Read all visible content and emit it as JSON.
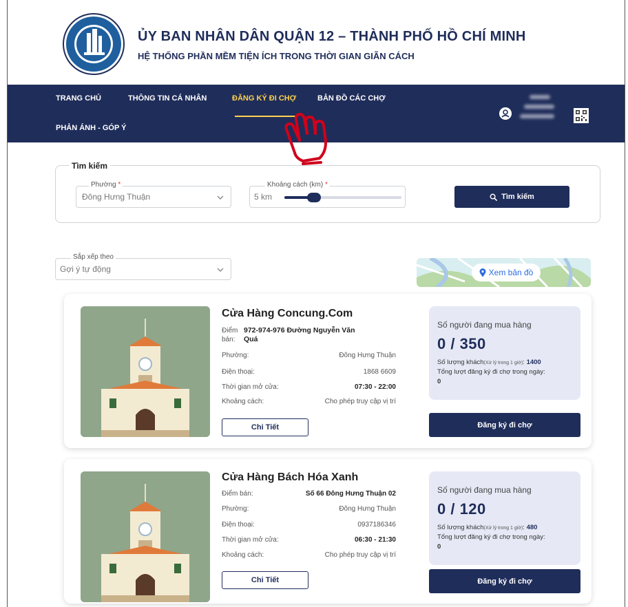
{
  "header": {
    "title": "ỦY BAN NHÂN DÂN QUẬN 12 – THÀNH PHỐ HỒ CHÍ MINH",
    "subtitle": "HỆ THỐNG PHẦN MỀM TIỆN ÍCH TRONG THỜI GIAN GIÃN CÁCH",
    "logo_text": "QUẬN 12 – THÀNH PHỐ HỒ CHÍ MINH"
  },
  "nav": {
    "items": [
      {
        "label": "TRANG CHỦ"
      },
      {
        "label": "THÔNG TIN CÁ NHÂN"
      },
      {
        "label": "ĐĂNG KÝ ĐI CHỢ"
      },
      {
        "label": "BẢN ĐỒ CÁC CHỢ"
      },
      {
        "label": "PHẢN ÁNH - GÓP Ý"
      }
    ],
    "active_index": 2
  },
  "search": {
    "legend": "Tìm kiếm",
    "ward_label": "Phường",
    "ward_value": "Đông Hưng Thuận",
    "distance_label": "Khoảng cách (km)",
    "distance_value": "5 km",
    "distance_slider_fraction": 0.25,
    "required_mark": "*",
    "button_label": "Tìm kiếm"
  },
  "sort": {
    "label": "Sắp xếp theo",
    "value": "Gợi ý tự động"
  },
  "map": {
    "button_label": "Xem bản đồ"
  },
  "stores": [
    {
      "name": "Cửa Hàng Concung.Com",
      "address_label": "Điểm bán:",
      "address_label_line1": "Điểm",
      "address_label_line2": "bán:",
      "address_line1": "972-974-976 Đường Nguyễn Văn",
      "address_line2": "Quá",
      "ward_label": "Phường:",
      "ward": "Đông Hưng Thuận",
      "phone_label": "Điện thoại:",
      "phone": "1868 6609",
      "hours_label": "Thời gian mở cửa:",
      "hours": "07:30 - 22:00",
      "distance_label": "Khoảng cách:",
      "distance": "Cho phép truy cập vị trí",
      "detail_button": "Chi Tiết",
      "stats_title": "Số người đang mua hàng",
      "count": "0 / 350",
      "capacity_label": "Số lượng khách",
      "capacity_note": "(Xử lý trong 1 giờ)",
      "capacity_value": "1400",
      "daily_label": "Tổng lượt đăng ký đi chợ trong ngày:",
      "daily_value": "0",
      "register_button": "Đăng ký đi chợ"
    },
    {
      "name": "Cửa Hàng Bách Hóa Xanh",
      "address_label": "Điểm bán:",
      "address": "Số 66 Đông Hưng Thuận 02",
      "ward_label": "Phường:",
      "ward": "Đông Hưng Thuận",
      "phone_label": "Điện thoại:",
      "phone": "0937186346",
      "hours_label": "Thời gian mở cửa:",
      "hours": "06:30 - 21:30",
      "distance_label": "Khoảng cách:",
      "distance": "Cho phép truy cập vị trí",
      "detail_button": "Chi Tiết",
      "stats_title": "Số người đang mua hàng",
      "count": "0 / 120",
      "capacity_label": "Số lượng khách",
      "capacity_note": "(Xử lý trong 1 giờ)",
      "capacity_value": "480",
      "daily_label": "Tổng lượt đăng ký đi chợ trong ngày:",
      "daily_value": "0",
      "register_button": "Đăng ký đi chợ"
    }
  ],
  "colors": {
    "primary": "#1f2d5a",
    "nav_active": "#ffd34d",
    "stats_bg": "#e6e9f5",
    "required": "#e53935",
    "hand_cursor": "#d0021b"
  },
  "icons": [
    "logo-emblem",
    "user-icon",
    "qr-code-icon",
    "hand-cursor-icon",
    "search-icon",
    "chevron-down-icon",
    "map-pin-icon",
    "market-building-icon"
  ]
}
